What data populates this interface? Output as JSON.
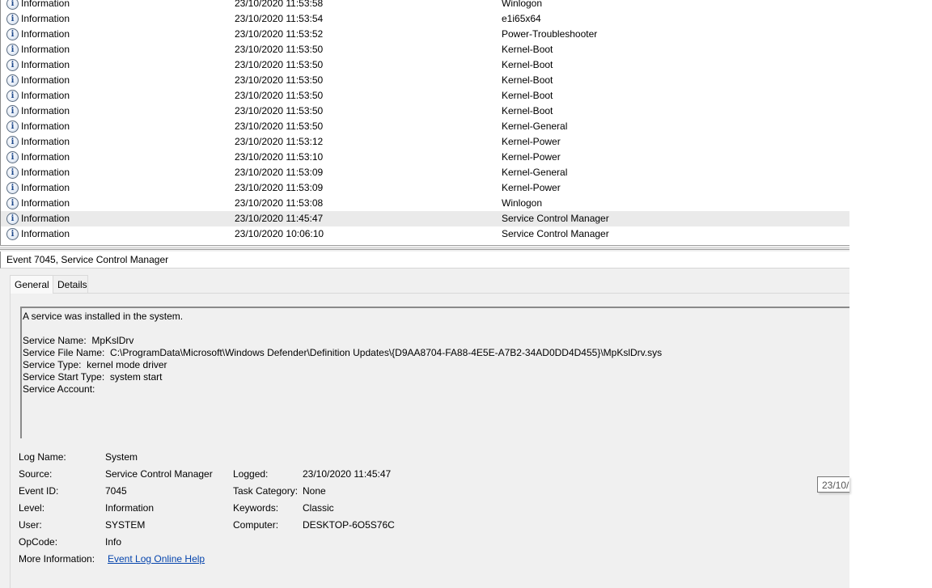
{
  "events": [
    {
      "level": "Information",
      "datetime": "23/10/2020 11:53:58",
      "source": "Winlogon"
    },
    {
      "level": "Information",
      "datetime": "23/10/2020 11:53:54",
      "source": "e1i65x64"
    },
    {
      "level": "Information",
      "datetime": "23/10/2020 11:53:52",
      "source": "Power-Troubleshooter"
    },
    {
      "level": "Information",
      "datetime": "23/10/2020 11:53:50",
      "source": "Kernel-Boot"
    },
    {
      "level": "Information",
      "datetime": "23/10/2020 11:53:50",
      "source": "Kernel-Boot"
    },
    {
      "level": "Information",
      "datetime": "23/10/2020 11:53:50",
      "source": "Kernel-Boot"
    },
    {
      "level": "Information",
      "datetime": "23/10/2020 11:53:50",
      "source": "Kernel-Boot"
    },
    {
      "level": "Information",
      "datetime": "23/10/2020 11:53:50",
      "source": "Kernel-Boot"
    },
    {
      "level": "Information",
      "datetime": "23/10/2020 11:53:50",
      "source": "Kernel-General"
    },
    {
      "level": "Information",
      "datetime": "23/10/2020 11:53:12",
      "source": "Kernel-Power"
    },
    {
      "level": "Information",
      "datetime": "23/10/2020 11:53:10",
      "source": "Kernel-Power"
    },
    {
      "level": "Information",
      "datetime": "23/10/2020 11:53:09",
      "source": "Kernel-General"
    },
    {
      "level": "Information",
      "datetime": "23/10/2020 11:53:09",
      "source": "Kernel-Power"
    },
    {
      "level": "Information",
      "datetime": "23/10/2020 11:53:08",
      "source": "Winlogon"
    },
    {
      "level": "Information",
      "datetime": "23/10/2020 11:45:47",
      "source": "Service Control Manager",
      "selected": true
    },
    {
      "level": "Information",
      "datetime": "23/10/2020 10:06:10",
      "source": "Service Control Manager"
    }
  ],
  "detail": {
    "header": "Event 7045, Service Control Manager",
    "tabs": [
      {
        "label": "General",
        "active": true
      },
      {
        "label": "Details",
        "active": false
      }
    ],
    "description": {
      "intro": "A service was installed in the system.",
      "lines": [
        "Service Name:  MpKslDrv",
        "Service File Name:  C:\\ProgramData\\Microsoft\\Windows Defender\\Definition Updates\\{D9AA8704-FA88-4E5E-A7B2-34AD0DD4D455}\\MpKslDrv.sys",
        "Service Type:  kernel mode driver",
        "Service Start Type:  system start",
        "Service Account:"
      ]
    },
    "properties": {
      "log_name_label": "Log Name:",
      "log_name": "System",
      "source_label": "Source:",
      "source": "Service Control Manager",
      "logged_label": "Logged:",
      "logged": "23/10/2020 11:45:47",
      "event_id_label": "Event ID:",
      "event_id": "7045",
      "task_category_label": "Task Category:",
      "task_category": "None",
      "level_label": "Level:",
      "level": "Information",
      "keywords_label": "Keywords:",
      "keywords": "Classic",
      "user_label": "User:",
      "user": "SYSTEM",
      "computer_label": "Computer:",
      "computer": "DESKTOP-6O5S76C",
      "opcode_label": "OpCode:",
      "opcode": "Info",
      "more_info_label": "More Information:",
      "more_info_link": "Event Log Online Help"
    },
    "tooltip": "23/10/"
  },
  "icons": {
    "level_information": "info-icon"
  }
}
